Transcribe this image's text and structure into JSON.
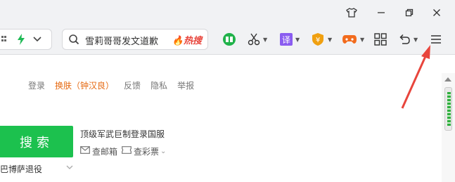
{
  "titlebar": {
    "controls": [
      {
        "name": "skin-shirt-icon"
      },
      {
        "name": "minimize-icon"
      },
      {
        "name": "restore-icon"
      },
      {
        "name": "close-icon"
      }
    ]
  },
  "address_bar": {
    "fragment_icon": "grid-fragment-icon",
    "bolt_icon": "lightning-icon",
    "dropdown_icon": "chevron-down-icon"
  },
  "search_box": {
    "query": "雪莉哥哥发文道歉",
    "hot_label": "热搜"
  },
  "toolbar_icons": [
    {
      "name": "green-book-icon",
      "color": "#20b24a"
    },
    {
      "name": "scissors-icon"
    },
    {
      "name": "translate-icon",
      "label": "译",
      "color": "#8a5cf0"
    },
    {
      "name": "shield-coin-icon",
      "label": "¥",
      "color": "#f0a010"
    },
    {
      "name": "gamepad-icon",
      "color": "#f26b1d"
    },
    {
      "name": "apps-grid-icon"
    },
    {
      "name": "undo-icon"
    },
    {
      "name": "menu-icon"
    }
  ],
  "page": {
    "links": {
      "login": "登录",
      "skin": "换肤（钟汉良）",
      "feedback": "反馈",
      "privacy": "隐私",
      "report": "举报"
    },
    "search_button": "搜索",
    "news_headline": "顶级军武巨制登录国服",
    "mailbox": "查邮箱",
    "lottery": "查彩票",
    "suggestion": "巴博萨退役"
  },
  "colors": {
    "accent_green": "#1cc14e",
    "skin_orange": "#e66a12",
    "annotation_red": "#e8453c"
  }
}
